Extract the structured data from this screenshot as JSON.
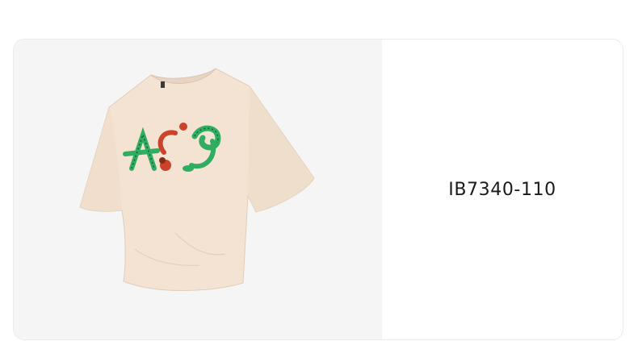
{
  "product": {
    "image": {
      "subject": "tshirt-illustration",
      "shirt_color": "#f4e3d3",
      "shirt_shade": "#e8d4c2",
      "graphic_green": "#2fae62",
      "graphic_red": "#c9442a"
    },
    "sku": "IB7340-110"
  }
}
